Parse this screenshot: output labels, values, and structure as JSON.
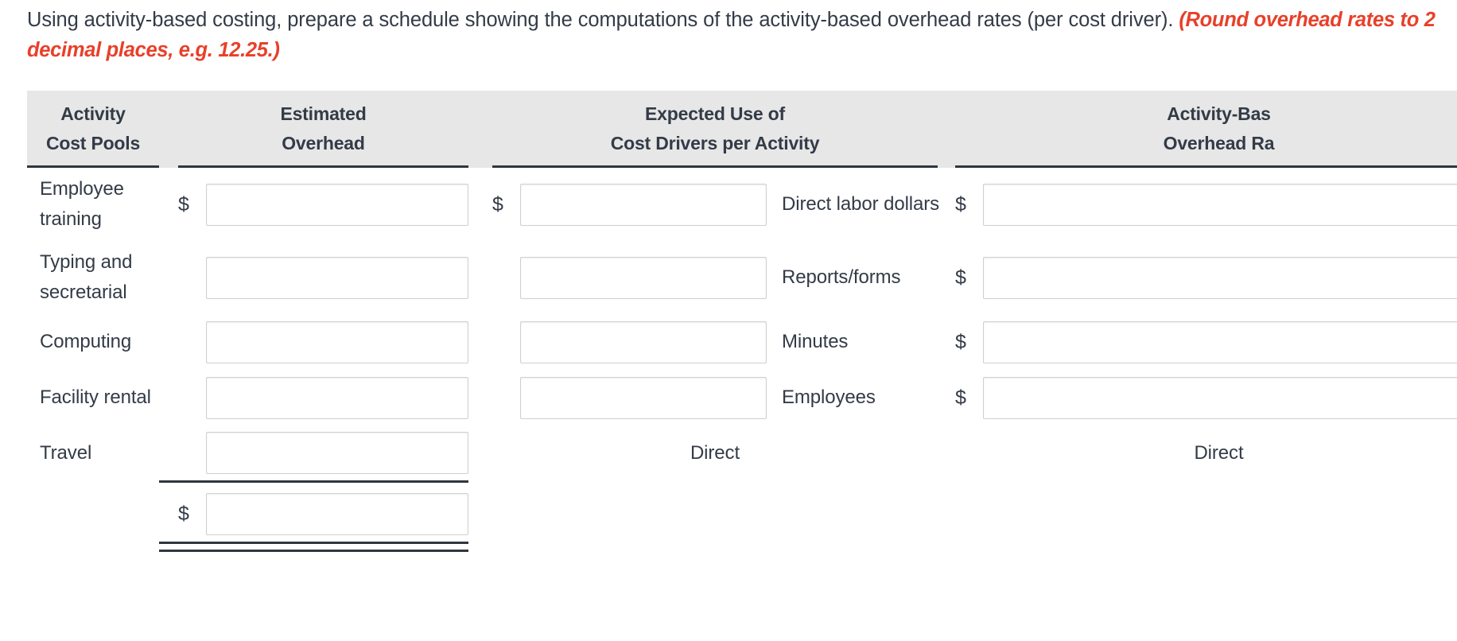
{
  "instructions": {
    "line1": "Using activity-based costing, prepare a schedule showing the computations of the activity-based overhead rates (per cost driver). ",
    "round_note": "(Round overhead rates to 2 decimal places, e.g. 12.25.)"
  },
  "table": {
    "headers": {
      "pool_line1": "Activity",
      "pool_line2": "Cost Pools",
      "overhead_line1": "Estimated",
      "overhead_line2": "Overhead",
      "expected_line1": "Expected Use of",
      "expected_line2": "Cost Drivers per Activity",
      "rate_line1": "Activity-Bas",
      "rate_line2": "Overhead Ra"
    },
    "rows": [
      {
        "pool": "Employee training",
        "overhead_dollar": "$",
        "overhead_value": "",
        "expected_dollar": "$",
        "expected_value": "",
        "driver": "Direct labor dollars",
        "rate_dollar": "$",
        "rate_value": ""
      },
      {
        "pool": "Typing and secretarial",
        "overhead_dollar": "",
        "overhead_value": "",
        "expected_dollar": "",
        "expected_value": "",
        "driver": "Reports/forms",
        "rate_dollar": "$",
        "rate_value": ""
      },
      {
        "pool": "Computing",
        "overhead_dollar": "",
        "overhead_value": "",
        "expected_dollar": "",
        "expected_value": "",
        "driver": "Minutes",
        "rate_dollar": "$",
        "rate_value": ""
      },
      {
        "pool": "Facility rental",
        "overhead_dollar": "",
        "overhead_value": "",
        "expected_dollar": "",
        "expected_value": "",
        "driver": "Employees",
        "rate_dollar": "$",
        "rate_value": ""
      },
      {
        "pool": "Travel",
        "overhead_dollar": "",
        "overhead_value": "",
        "expected_text": "Direct",
        "driver": "",
        "rate_text": "Direct"
      }
    ],
    "total_row": {
      "dollar": "$",
      "value": ""
    },
    "input_placeholder": ""
  },
  "colors": {
    "header_bg": "#e7e7e7",
    "text": "#333b47",
    "accent_red": "#e8402a",
    "rule": "#2f3640",
    "input_border": "#cfd0d2"
  }
}
